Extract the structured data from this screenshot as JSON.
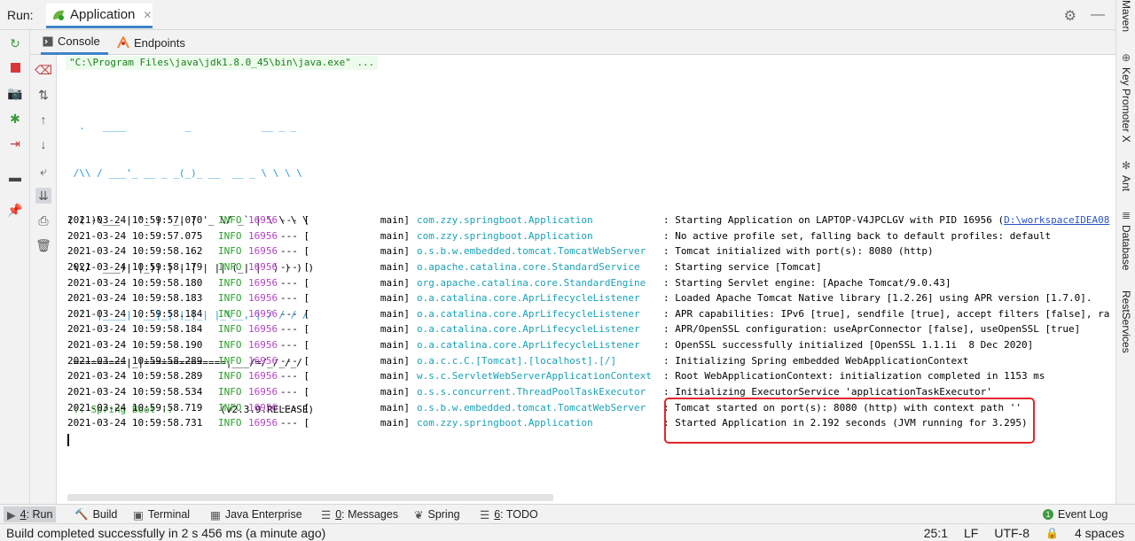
{
  "run": {
    "label": "Run:",
    "tab_title": "Application",
    "close": "✕"
  },
  "subtabs": {
    "console": "Console",
    "endpoints": "Endpoints"
  },
  "console": {
    "command": "\"C:\\Program Files\\java\\jdk1.8.0_45\\bin\\java.exe\" ...",
    "banner_lines": [
      "  .   ____          _            __ _ _",
      " /\\\\ / ___'_ __ _ _(_)_ __  __ _ \\ \\ \\ \\",
      "( ( )\\___ | '_ | '_| | '_ \\/ _` | \\ \\ \\ \\",
      " \\\\/  ___)| |_)| | | | | || (_| |  ) ) ) )",
      "  '  |____| .__|_| |_|_| |_\\__, | / / / /",
      " =========|_|==============|___/=/_/_/_/"
    ],
    "boot_label": " :: Spring Boot :: ",
    "boot_version": "       (v2.3.9.RELEASE)",
    "rows": [
      {
        "ts": "2021-03-24 10:59:57.070",
        "level": "INFO",
        "pid": "16956",
        "sep": "--- [",
        "thread": "main]",
        "logger": "com.zzy.springboot.Application",
        "msg": ": Starting Application on LAPTOP-V4JPCLGV with PID 16956 (",
        "link": "D:\\workspaceIDEA08"
      },
      {
        "ts": "2021-03-24 10:59:57.075",
        "level": "INFO",
        "pid": "16956",
        "sep": "--- [",
        "thread": "main]",
        "logger": "com.zzy.springboot.Application",
        "msg": ": No active profile set, falling back to default profiles: default",
        "link": ""
      },
      {
        "ts": "2021-03-24 10:59:58.162",
        "level": "INFO",
        "pid": "16956",
        "sep": "--- [",
        "thread": "main]",
        "logger": "o.s.b.w.embedded.tomcat.TomcatWebServer",
        "msg": ": Tomcat initialized with port(s): 8080 (http)",
        "link": ""
      },
      {
        "ts": "2021-03-24 10:59:58.179",
        "level": "INFO",
        "pid": "16956",
        "sep": "--- [",
        "thread": "main]",
        "logger": "o.apache.catalina.core.StandardService",
        "msg": ": Starting service [Tomcat]",
        "link": ""
      },
      {
        "ts": "2021-03-24 10:59:58.180",
        "level": "INFO",
        "pid": "16956",
        "sep": "--- [",
        "thread": "main]",
        "logger": "org.apache.catalina.core.StandardEngine",
        "msg": ": Starting Servlet engine: [Apache Tomcat/9.0.43]",
        "link": ""
      },
      {
        "ts": "2021-03-24 10:59:58.183",
        "level": "INFO",
        "pid": "16956",
        "sep": "--- [",
        "thread": "main]",
        "logger": "o.a.catalina.core.AprLifecycleListener",
        "msg": ": Loaded Apache Tomcat Native library [1.2.26] using APR version [1.7.0].",
        "link": ""
      },
      {
        "ts": "2021-03-24 10:59:58.184",
        "level": "INFO",
        "pid": "16956",
        "sep": "--- [",
        "thread": "main]",
        "logger": "o.a.catalina.core.AprLifecycleListener",
        "msg": ": APR capabilities: IPv6 [true], sendfile [true], accept filters [false], ra",
        "link": ""
      },
      {
        "ts": "2021-03-24 10:59:58.184",
        "level": "INFO",
        "pid": "16956",
        "sep": "--- [",
        "thread": "main]",
        "logger": "o.a.catalina.core.AprLifecycleListener",
        "msg": ": APR/OpenSSL configuration: useAprConnector [false], useOpenSSL [true]",
        "link": ""
      },
      {
        "ts": "2021-03-24 10:59:58.190",
        "level": "INFO",
        "pid": "16956",
        "sep": "--- [",
        "thread": "main]",
        "logger": "o.a.catalina.core.AprLifecycleListener",
        "msg": ": OpenSSL successfully initialized [OpenSSL 1.1.1i  8 Dec 2020]",
        "link": ""
      },
      {
        "ts": "2021-03-24 10:59:58.289",
        "level": "INFO",
        "pid": "16956",
        "sep": "--- [",
        "thread": "main]",
        "logger": "o.a.c.c.C.[Tomcat].[localhost].[/]",
        "msg": ": Initializing Spring embedded WebApplicationContext",
        "link": ""
      },
      {
        "ts": "2021-03-24 10:59:58.289",
        "level": "INFO",
        "pid": "16956",
        "sep": "--- [",
        "thread": "main]",
        "logger": "w.s.c.ServletWebServerApplicationContext",
        "msg": ": Root WebApplicationContext: initialization completed in 1153 ms",
        "link": ""
      },
      {
        "ts": "2021-03-24 10:59:58.534",
        "level": "INFO",
        "pid": "16956",
        "sep": "--- [",
        "thread": "main]",
        "logger": "o.s.s.concurrent.ThreadPoolTaskExecutor",
        "msg": ": Initializing ExecutorService 'applicationTaskExecutor'",
        "link": ""
      },
      {
        "ts": "2021-03-24 10:59:58.719",
        "level": "INFO",
        "pid": "16956",
        "sep": "--- [",
        "thread": "main]",
        "logger": "o.s.b.w.embedded.tomcat.TomcatWebServer",
        "msg": ": Tomcat started on port(s): 8080 (http) with context path ''",
        "link": ""
      },
      {
        "ts": "2021-03-24 10:59:58.731",
        "level": "INFO",
        "pid": "16956",
        "sep": "--- [",
        "thread": "main]",
        "logger": "com.zzy.springboot.Application",
        "msg": ": Started Application in 2.192 seconds (JVM running for 3.295)",
        "link": ""
      }
    ]
  },
  "right_tools": [
    "Maven",
    "Key Promoter X",
    "Ant",
    "Database",
    "RestServices"
  ],
  "bottom_tools": {
    "run": {
      "num": "4",
      "label": ": Run"
    },
    "build": "Build",
    "terminal": "Terminal",
    "java_enterprise": "Java Enterprise",
    "messages": {
      "num": "0",
      "label": ": Messages"
    },
    "spring": "Spring",
    "todo": {
      "num": "6",
      "label": ": TODO"
    },
    "event_log": "Event Log"
  },
  "status": {
    "message": "Build completed successfully in 2 s 456 ms (a minute ago)",
    "position": "25:1",
    "line_sep": "LF",
    "encoding": "UTF-8",
    "indent": "4 spaces"
  }
}
